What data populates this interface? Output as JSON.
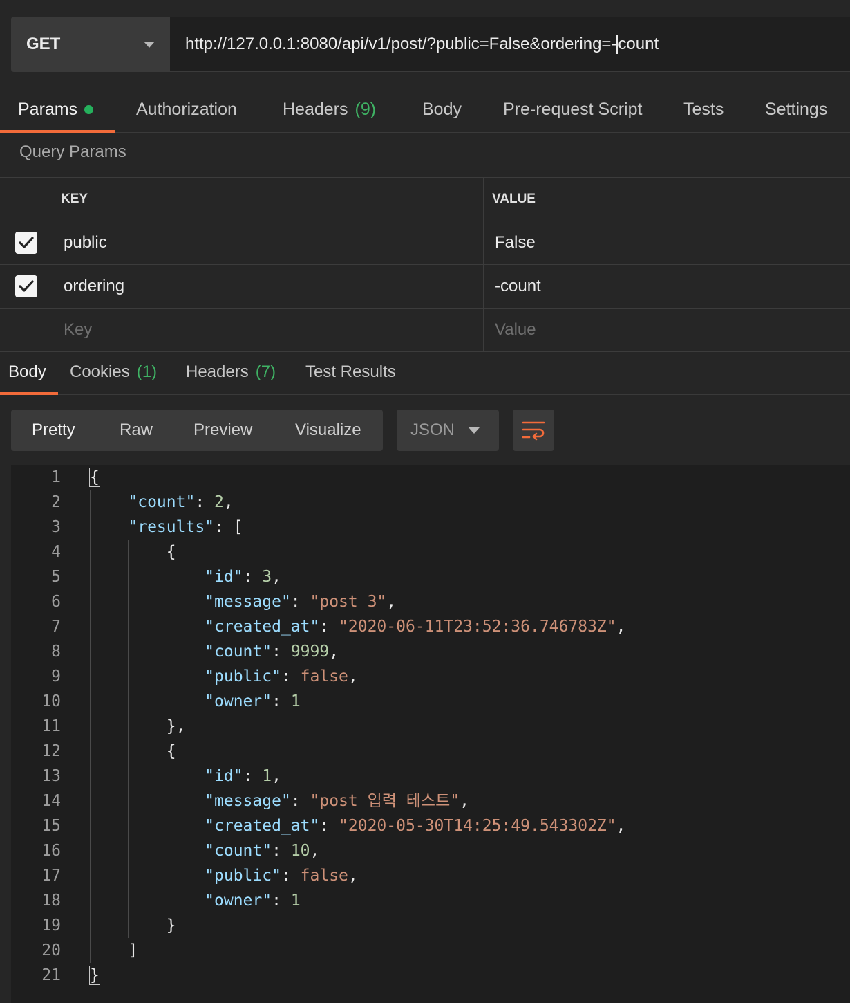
{
  "request": {
    "method": "GET",
    "url_before_cursor": "http://127.0.0.1:8080/api/v1/post/?public=False&ordering=-",
    "url_after_cursor": "count"
  },
  "request_tabs": [
    {
      "label": "Params",
      "active": true,
      "dot": true
    },
    {
      "label": "Authorization"
    },
    {
      "label": "Headers",
      "count": "(9)"
    },
    {
      "label": "Body"
    },
    {
      "label": "Pre-request Script"
    },
    {
      "label": "Tests"
    },
    {
      "label": "Settings"
    }
  ],
  "query_params": {
    "title": "Query Params",
    "headers": {
      "key": "KEY",
      "value": "VALUE"
    },
    "rows": [
      {
        "checked": true,
        "key": "public",
        "value": "False"
      },
      {
        "checked": true,
        "key": "ordering",
        "value": "-count"
      }
    ],
    "placeholder": {
      "key": "Key",
      "value": "Value"
    }
  },
  "response_tabs": [
    {
      "label": "Body",
      "active": true
    },
    {
      "label": "Cookies",
      "count": "(1)"
    },
    {
      "label": "Headers",
      "count": "(7)"
    },
    {
      "label": "Test Results"
    }
  ],
  "view_modes": [
    "Pretty",
    "Raw",
    "Preview",
    "Visualize"
  ],
  "format": "JSON",
  "code_lines": [
    {
      "n": "1",
      "t": [
        [
          "p",
          "{"
        ]
      ]
    },
    {
      "n": "2",
      "t": [
        [
          "p",
          "    "
        ],
        [
          "k",
          "\"count\""
        ],
        [
          "p",
          ": "
        ],
        [
          "n",
          "2"
        ],
        [
          "p",
          ","
        ]
      ]
    },
    {
      "n": "3",
      "t": [
        [
          "p",
          "    "
        ],
        [
          "k",
          "\"results\""
        ],
        [
          "p",
          ": ["
        ]
      ]
    },
    {
      "n": "4",
      "t": [
        [
          "p",
          "        {"
        ]
      ]
    },
    {
      "n": "5",
      "t": [
        [
          "p",
          "            "
        ],
        [
          "k",
          "\"id\""
        ],
        [
          "p",
          ": "
        ],
        [
          "n",
          "3"
        ],
        [
          "p",
          ","
        ]
      ]
    },
    {
      "n": "6",
      "t": [
        [
          "p",
          "            "
        ],
        [
          "k",
          "\"message\""
        ],
        [
          "p",
          ": "
        ],
        [
          "s",
          "\"post 3\""
        ],
        [
          "p",
          ","
        ]
      ]
    },
    {
      "n": "7",
      "t": [
        [
          "p",
          "            "
        ],
        [
          "k",
          "\"created_at\""
        ],
        [
          "p",
          ": "
        ],
        [
          "s",
          "\"2020-06-11T23:52:36.746783Z\""
        ],
        [
          "p",
          ","
        ]
      ]
    },
    {
      "n": "8",
      "t": [
        [
          "p",
          "            "
        ],
        [
          "k",
          "\"count\""
        ],
        [
          "p",
          ": "
        ],
        [
          "n",
          "9999"
        ],
        [
          "p",
          ","
        ]
      ]
    },
    {
      "n": "9",
      "t": [
        [
          "p",
          "            "
        ],
        [
          "k",
          "\"public\""
        ],
        [
          "p",
          ": "
        ],
        [
          "b",
          "false"
        ],
        [
          "p",
          ","
        ]
      ]
    },
    {
      "n": "10",
      "t": [
        [
          "p",
          "            "
        ],
        [
          "k",
          "\"owner\""
        ],
        [
          "p",
          ": "
        ],
        [
          "n",
          "1"
        ]
      ]
    },
    {
      "n": "11",
      "t": [
        [
          "p",
          "        },"
        ]
      ]
    },
    {
      "n": "12",
      "t": [
        [
          "p",
          "        {"
        ]
      ]
    },
    {
      "n": "13",
      "t": [
        [
          "p",
          "            "
        ],
        [
          "k",
          "\"id\""
        ],
        [
          "p",
          ": "
        ],
        [
          "n",
          "1"
        ],
        [
          "p",
          ","
        ]
      ]
    },
    {
      "n": "14",
      "t": [
        [
          "p",
          "            "
        ],
        [
          "k",
          "\"message\""
        ],
        [
          "p",
          ": "
        ],
        [
          "s",
          "\"post 입력 테스트\""
        ],
        [
          "p",
          ","
        ]
      ]
    },
    {
      "n": "15",
      "t": [
        [
          "p",
          "            "
        ],
        [
          "k",
          "\"created_at\""
        ],
        [
          "p",
          ": "
        ],
        [
          "s",
          "\"2020-05-30T14:25:49.543302Z\""
        ],
        [
          "p",
          ","
        ]
      ]
    },
    {
      "n": "16",
      "t": [
        [
          "p",
          "            "
        ],
        [
          "k",
          "\"count\""
        ],
        [
          "p",
          ": "
        ],
        [
          "n",
          "10"
        ],
        [
          "p",
          ","
        ]
      ]
    },
    {
      "n": "17",
      "t": [
        [
          "p",
          "            "
        ],
        [
          "k",
          "\"public\""
        ],
        [
          "p",
          ": "
        ],
        [
          "b",
          "false"
        ],
        [
          "p",
          ","
        ]
      ]
    },
    {
      "n": "18",
      "t": [
        [
          "p",
          "            "
        ],
        [
          "k",
          "\"owner\""
        ],
        [
          "p",
          ": "
        ],
        [
          "n",
          "1"
        ]
      ]
    },
    {
      "n": "19",
      "t": [
        [
          "p",
          "        }"
        ]
      ]
    },
    {
      "n": "20",
      "t": [
        [
          "p",
          "    ]"
        ]
      ]
    },
    {
      "n": "21",
      "t": [
        [
          "p",
          "}"
        ]
      ]
    }
  ],
  "colors": {
    "accent": "#f26b3a",
    "status_green": "#25b05c",
    "json_key": "#9cdcfe",
    "json_string": "#ce9178",
    "json_number": "#b5cea8"
  }
}
